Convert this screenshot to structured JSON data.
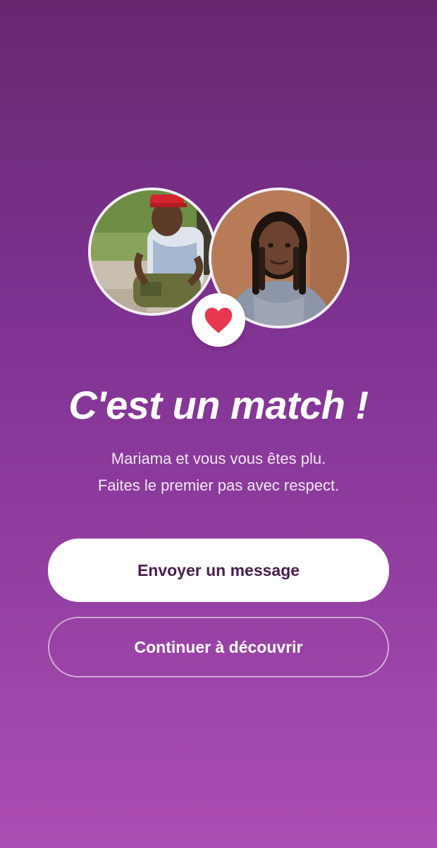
{
  "match": {
    "title": "C'est un match !",
    "subtitle_line1": "Mariama et vous vous êtes plu.",
    "subtitle_line2": "Faites le premier pas avec respect."
  },
  "actions": {
    "primary_label": "Envoyer un message",
    "secondary_label": "Continuer à découvrir"
  },
  "icons": {
    "heart": "heart-icon"
  },
  "colors": {
    "background_top": "#67286f",
    "background_bottom": "#ad4eb3",
    "heart": "#e8384f",
    "primary_button_text": "#4a1d4e"
  }
}
